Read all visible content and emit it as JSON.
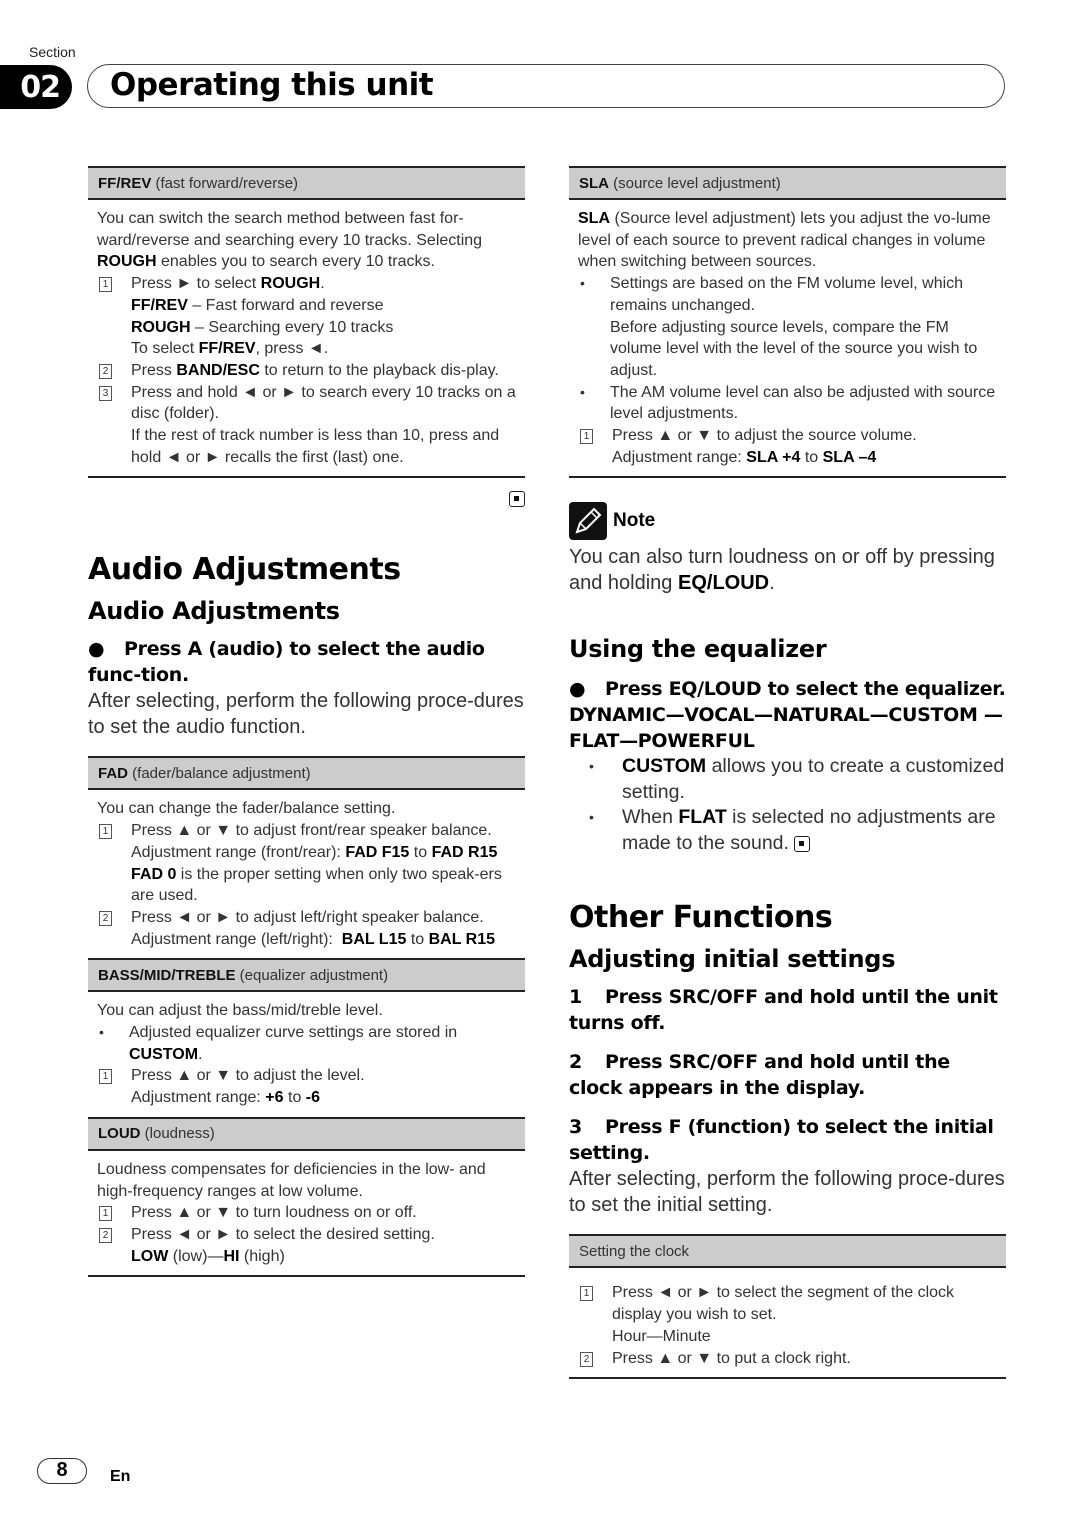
{
  "header": {
    "section_label": "Section",
    "section_number": "02",
    "title": "Operating this unit"
  },
  "left": {
    "ffrev": {
      "head_bold": "FF/REV",
      "head_rest": " (fast forward/reverse)",
      "intro_1": "You can switch the search method between fast for-ward/reverse and searching every 10 tracks. Selecting ",
      "intro_bold": "ROUGH",
      "intro_2": " enables you to search every 10 tracks.",
      "step1_num": "1",
      "step1_a": "Press ► to select ",
      "step1_b": "ROUGH",
      "step1_c": ".",
      "opt1_bold": "FF/REV",
      "opt1_rest": " – Fast forward and reverse",
      "opt2_bold": "ROUGH",
      "opt2_rest": " – Searching every 10 tracks",
      "to_select_a": "To select ",
      "to_select_b": "FF/REV",
      "to_select_c": ", press ◄.",
      "step2_num": "2",
      "step2_a": "Press ",
      "step2_b": "BAND/ESC",
      "step2_c": " to return to the playback dis-play.",
      "step3_num": "3",
      "step3_a": "Press and hold ◄ or ► to search every 10 tracks on a disc (folder).",
      "step3_b": "If the rest of track number is less than 10, press and hold ◄ or ► recalls the first (last) one."
    },
    "heading1": "Audio Adjustments",
    "heading2": "Audio Adjustments",
    "instruction": "Press A (audio) to select the audio func-tion.",
    "instruction_bullet": "●",
    "after_text": "After selecting, perform the following proce-dures to set the audio function.",
    "fad": {
      "head_bold": "FAD",
      "head_rest": " (fader/balance adjustment)",
      "intro": "You can change the fader/balance setting.",
      "step1_num": "1",
      "step1_a": "Press ▲ or ▼ to adjust front/rear speaker balance.",
      "step1_range_a": "Adjustment range (front/rear): ",
      "step1_range_b": "FAD F15",
      "step1_range_c": " to ",
      "step1_range_d": "FAD R15",
      "step1_note_b": "FAD 0",
      "step1_note_rest": " is the proper setting when only two speak-ers are used.",
      "step2_num": "2",
      "step2_a": "Press ◄ or ► to adjust left/right speaker balance.",
      "step2_range_a": "Adjustment range (left/right):  ",
      "step2_range_b": "BAL L15",
      "step2_range_c": " to ",
      "step2_range_d": "BAL R15"
    },
    "bmt": {
      "head_bold": "BASS/MID/TREBLE",
      "head_rest": " (equalizer adjustment)",
      "intro": "You can adjust the bass/mid/treble level.",
      "bullet_a": "Adjusted equalizer curve settings are stored in ",
      "bullet_b": "CUSTOM",
      "bullet_c": ".",
      "step1_num": "1",
      "step1_a": "Press ▲ or ▼ to adjust the level.",
      "range_a": "Adjustment range: ",
      "range_b": "+6",
      "range_c": " to ",
      "range_d": "-6"
    },
    "loud": {
      "head_bold": "LOUD",
      "head_rest": " (loudness)",
      "intro": "Loudness compensates for deficiencies in the low- and high-frequency ranges at low volume.",
      "step1_num": "1",
      "step1": "Press ▲ or ▼ to turn loudness on or off.",
      "step2_num": "2",
      "step2": "Press ◄ or ► to select the desired setting.",
      "opt_a": "LOW",
      "opt_b": " (low)—",
      "opt_c": "HI",
      "opt_d": " (high)"
    }
  },
  "right": {
    "sla": {
      "head_bold": "SLA",
      "head_rest": " (source level adjustment)",
      "intro_bold": "SLA",
      "intro_rest": " (Source level adjustment) lets you adjust the vo-lume level of each source to prevent radical changes in volume when switching between sources.",
      "bullet1_a": "Settings are based on the FM volume level, which remains unchanged.",
      "bullet1_b": "Before adjusting source levels, compare the FM volume level with the level of the source you wish to adjust.",
      "bullet2": "The AM volume level can also be adjusted with source level adjustments.",
      "step1_num": "1",
      "step1": "Press ▲ or ▼ to adjust the source volume.",
      "range_a": "Adjustment range: ",
      "range_b": "SLA +4",
      "range_c": " to ",
      "range_d": "SLA –4"
    },
    "note": {
      "label": "Note",
      "text_a": "You can also turn loudness on or off by pressing and holding ",
      "text_b": "EQ/LOUD",
      "text_c": "."
    },
    "eq": {
      "heading": "Using the equalizer",
      "instruction_bullet": "●",
      "instruction": "Press EQ/LOUD to select the equalizer.",
      "sequence": "DYNAMIC—VOCAL—NATURAL—CUSTOM —FLAT—POWERFUL",
      "bullet1_b": "CUSTOM",
      "bullet1_rest": " allows you to create a customized setting.",
      "bullet2_a": "When ",
      "bullet2_b": "FLAT",
      "bullet2_c": " is selected no adjustments are made to the sound."
    },
    "other": {
      "heading1": "Other Functions",
      "heading2": "Adjusting initial settings",
      "step1_num": "1",
      "step1": "Press SRC/OFF and hold until the unit turns off.",
      "step2_num": "2",
      "step2": "Press SRC/OFF and hold until the clock appears in the display.",
      "step3_num": "3",
      "step3": "Press F (function) to select the initial setting.",
      "after_text": "After selecting, perform the following proce-dures to set the initial setting."
    },
    "clock": {
      "head": "Setting the clock",
      "step1_num": "1",
      "step1": "Press ◄ or ► to select the segment of the clock display you wish to set.",
      "step1_opts": "Hour—Minute",
      "step2_num": "2",
      "step2": "Press ▲ or ▼ to put a clock right."
    }
  },
  "footer": {
    "page_number": "8",
    "language": "En"
  }
}
